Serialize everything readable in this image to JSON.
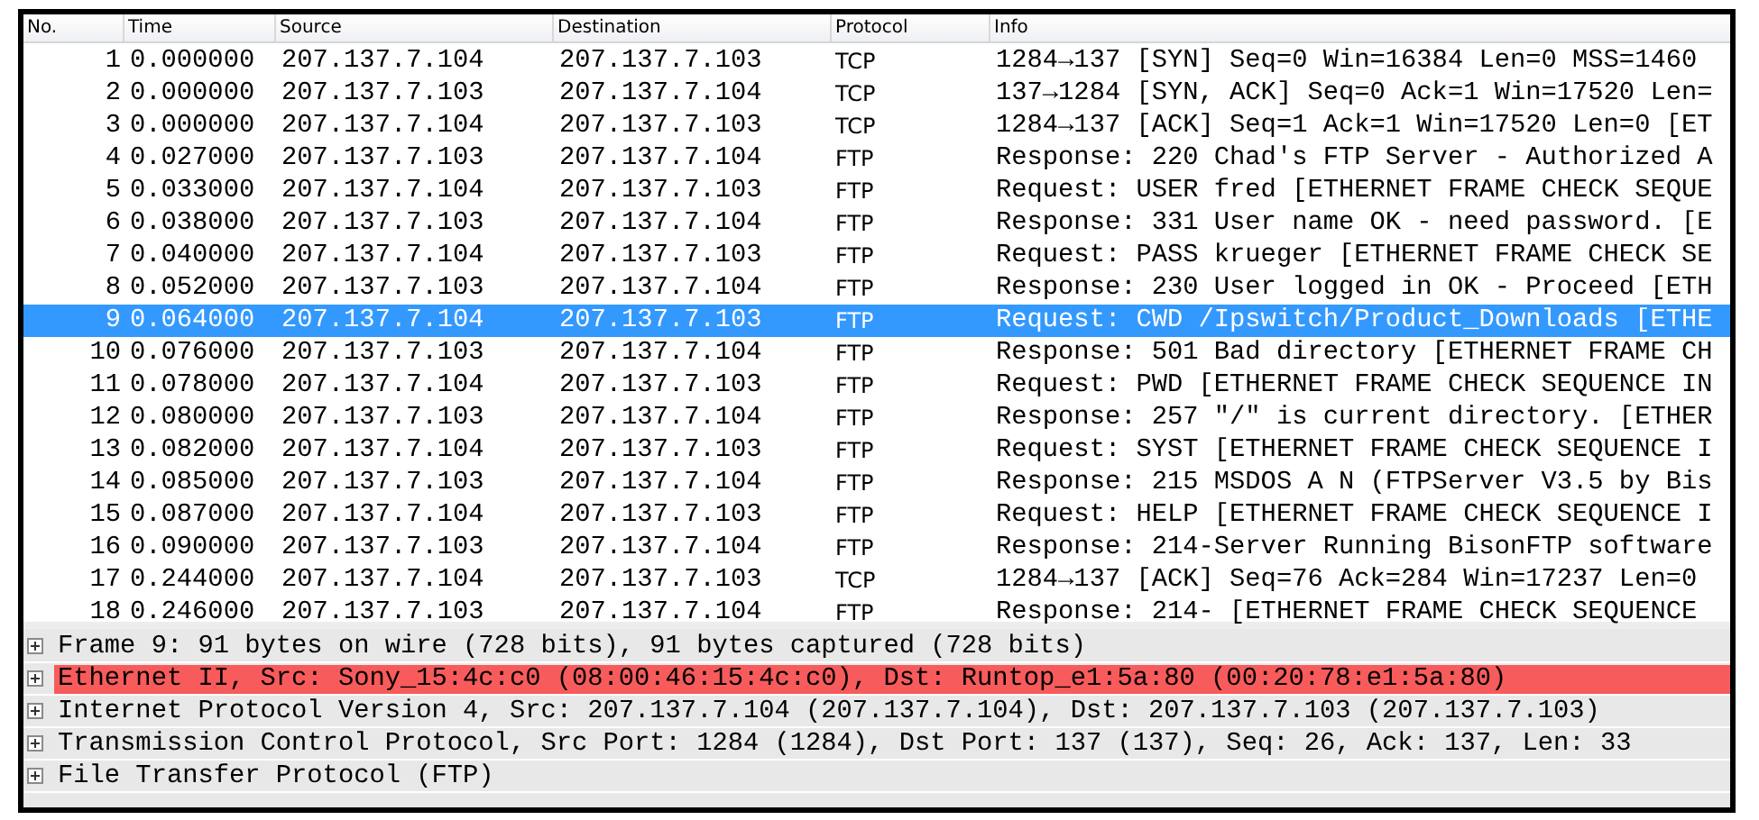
{
  "packet_list": {
    "columns": [
      "No.",
      "Time",
      "Source",
      "Destination",
      "Protocol",
      "Info"
    ],
    "rows": [
      {
        "no": "1",
        "time": "0.000000",
        "source": "207.137.7.104",
        "destination": "207.137.7.103",
        "protocol": "TCP",
        "info": "1284→137 [SYN] Seq=0 Win=16384 Len=0 MSS=1460",
        "selected": false
      },
      {
        "no": "2",
        "time": "0.000000",
        "source": "207.137.7.103",
        "destination": "207.137.7.104",
        "protocol": "TCP",
        "info": "137→1284 [SYN, ACK] Seq=0 Ack=1 Win=17520 Len=",
        "selected": false
      },
      {
        "no": "3",
        "time": "0.000000",
        "source": "207.137.7.104",
        "destination": "207.137.7.103",
        "protocol": "TCP",
        "info": "1284→137 [ACK] Seq=1 Ack=1 Win=17520 Len=0 [ET",
        "selected": false
      },
      {
        "no": "4",
        "time": "0.027000",
        "source": "207.137.7.103",
        "destination": "207.137.7.104",
        "protocol": "FTP",
        "info": "Response: 220 Chad's FTP Server - Authorized A",
        "selected": false
      },
      {
        "no": "5",
        "time": "0.033000",
        "source": "207.137.7.104",
        "destination": "207.137.7.103",
        "protocol": "FTP",
        "info": "Request: USER fred [ETHERNET FRAME CHECK SEQUE",
        "selected": false
      },
      {
        "no": "6",
        "time": "0.038000",
        "source": "207.137.7.103",
        "destination": "207.137.7.104",
        "protocol": "FTP",
        "info": "Response: 331 User name OK - need password. [E",
        "selected": false
      },
      {
        "no": "7",
        "time": "0.040000",
        "source": "207.137.7.104",
        "destination": "207.137.7.103",
        "protocol": "FTP",
        "info": "Request: PASS krueger [ETHERNET FRAME CHECK SE",
        "selected": false
      },
      {
        "no": "8",
        "time": "0.052000",
        "source": "207.137.7.103",
        "destination": "207.137.7.104",
        "protocol": "FTP",
        "info": "Response: 230 User logged in OK - Proceed [ETH",
        "selected": false
      },
      {
        "no": "9",
        "time": "0.064000",
        "source": "207.137.7.104",
        "destination": "207.137.7.103",
        "protocol": "FTP",
        "info": "Request: CWD /Ipswitch/Product_Downloads [ETHE",
        "selected": true
      },
      {
        "no": "10",
        "time": "0.076000",
        "source": "207.137.7.103",
        "destination": "207.137.7.104",
        "protocol": "FTP",
        "info": "Response: 501 Bad directory [ETHERNET FRAME CH",
        "selected": false
      },
      {
        "no": "11",
        "time": "0.078000",
        "source": "207.137.7.104",
        "destination": "207.137.7.103",
        "protocol": "FTP",
        "info": "Request: PWD [ETHERNET FRAME CHECK SEQUENCE IN",
        "selected": false
      },
      {
        "no": "12",
        "time": "0.080000",
        "source": "207.137.7.103",
        "destination": "207.137.7.104",
        "protocol": "FTP",
        "info": "Response: 257 \"/\" is current directory. [ETHER",
        "selected": false
      },
      {
        "no": "13",
        "time": "0.082000",
        "source": "207.137.7.104",
        "destination": "207.137.7.103",
        "protocol": "FTP",
        "info": "Request: SYST [ETHERNET FRAME CHECK SEQUENCE I",
        "selected": false
      },
      {
        "no": "14",
        "time": "0.085000",
        "source": "207.137.7.103",
        "destination": "207.137.7.104",
        "protocol": "FTP",
        "info": "Response: 215 MSDOS A N (FTPServer V3.5 by Bis",
        "selected": false
      },
      {
        "no": "15",
        "time": "0.087000",
        "source": "207.137.7.104",
        "destination": "207.137.7.103",
        "protocol": "FTP",
        "info": "Request: HELP [ETHERNET FRAME CHECK SEQUENCE I",
        "selected": false
      },
      {
        "no": "16",
        "time": "0.090000",
        "source": "207.137.7.103",
        "destination": "207.137.7.104",
        "protocol": "FTP",
        "info": "Response: 214-Server Running BisonFTP software",
        "selected": false
      },
      {
        "no": "17",
        "time": "0.244000",
        "source": "207.137.7.104",
        "destination": "207.137.7.103",
        "protocol": "TCP",
        "info": "1284→137 [ACK] Seq=76 Ack=284 Win=17237 Len=0",
        "selected": false
      },
      {
        "no": "18",
        "time": "0.246000",
        "source": "207.137.7.103",
        "destination": "207.137.7.104",
        "protocol": "FTP",
        "info": "Response: 214- [ETHERNET FRAME CHECK SEQUENCE",
        "selected": false
      }
    ]
  },
  "packet_details": [
    {
      "text": "Frame 9: 91 bytes on wire (728 bits), 91 bytes captured (728 bits)",
      "expanded": false,
      "flagged": false
    },
    {
      "text": "Ethernet II, Src: Sony_15:4c:c0 (08:00:46:15:4c:c0), Dst: Runtop_e1:5a:80 (00:20:78:e1:5a:80)",
      "expanded": false,
      "flagged": true
    },
    {
      "text": "Internet Protocol Version 4, Src: 207.137.7.104 (207.137.7.104), Dst: 207.137.7.103 (207.137.7.103)",
      "expanded": false,
      "flagged": false
    },
    {
      "text": "Transmission Control Protocol, Src Port: 1284 (1284), Dst Port: 137 (137), Seq: 26, Ack: 137, Len: 33",
      "expanded": false,
      "flagged": false
    },
    {
      "text": "File Transfer Protocol (FTP)",
      "expanded": false,
      "flagged": false
    }
  ]
}
